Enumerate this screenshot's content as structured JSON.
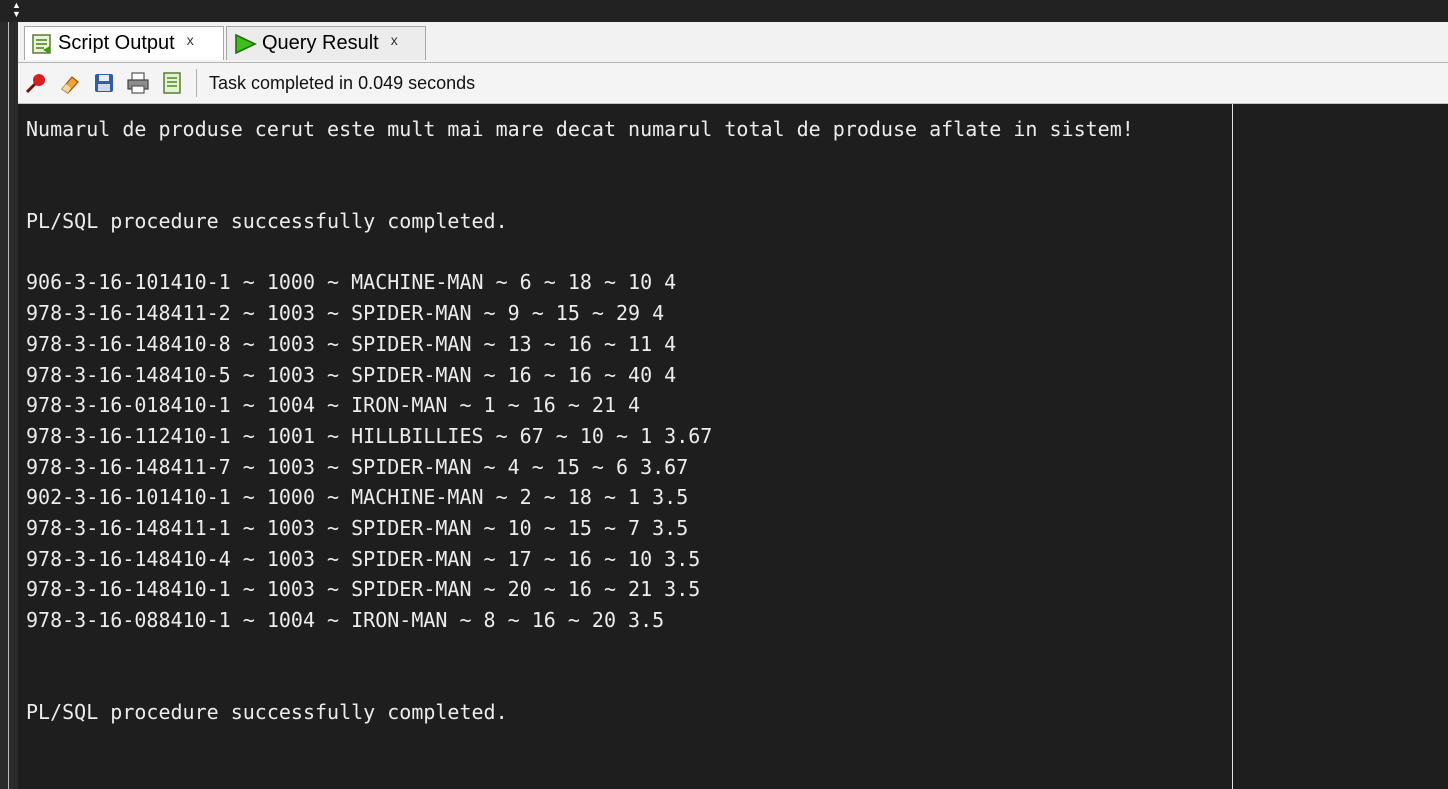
{
  "tabs": [
    {
      "label": "Script Output",
      "close": "x",
      "icon": "script-output-icon",
      "active": true
    },
    {
      "label": "Query Result",
      "close": "x",
      "icon": "run-triangle-icon",
      "active": false
    }
  ],
  "toolbar": {
    "icons": [
      "pin-icon",
      "eraser-icon",
      "save-icon",
      "print-icon",
      "script-doc-icon"
    ],
    "status": "Task completed in 0.049 seconds"
  },
  "output": {
    "lines": [
      "Numarul de produse cerut este mult mai mare decat numarul total de produse aflate in sistem!",
      "",
      "",
      "PL/SQL procedure successfully completed.",
      "",
      "906-3-16-101410-1 ~ 1000 ~ MACHINE-MAN ~ 6 ~ 18 ~ 10 4",
      "978-3-16-148411-2 ~ 1003 ~ SPIDER-MAN ~ 9 ~ 15 ~ 29 4",
      "978-3-16-148410-8 ~ 1003 ~ SPIDER-MAN ~ 13 ~ 16 ~ 11 4",
      "978-3-16-148410-5 ~ 1003 ~ SPIDER-MAN ~ 16 ~ 16 ~ 40 4",
      "978-3-16-018410-1 ~ 1004 ~ IRON-MAN ~ 1 ~ 16 ~ 21 4",
      "978-3-16-112410-1 ~ 1001 ~ HILLBILLIES ~ 67 ~ 10 ~ 1 3.67",
      "978-3-16-148411-7 ~ 1003 ~ SPIDER-MAN ~ 4 ~ 15 ~ 6 3.67",
      "902-3-16-101410-1 ~ 1000 ~ MACHINE-MAN ~ 2 ~ 18 ~ 1 3.5",
      "978-3-16-148411-1 ~ 1003 ~ SPIDER-MAN ~ 10 ~ 15 ~ 7 3.5",
      "978-3-16-148410-4 ~ 1003 ~ SPIDER-MAN ~ 17 ~ 16 ~ 10 3.5",
      "978-3-16-148410-1 ~ 1003 ~ SPIDER-MAN ~ 20 ~ 16 ~ 21 3.5",
      "978-3-16-088410-1 ~ 1004 ~ IRON-MAN ~ 8 ~ 16 ~ 20 3.5",
      "",
      "",
      "PL/SQL procedure successfully completed."
    ]
  }
}
